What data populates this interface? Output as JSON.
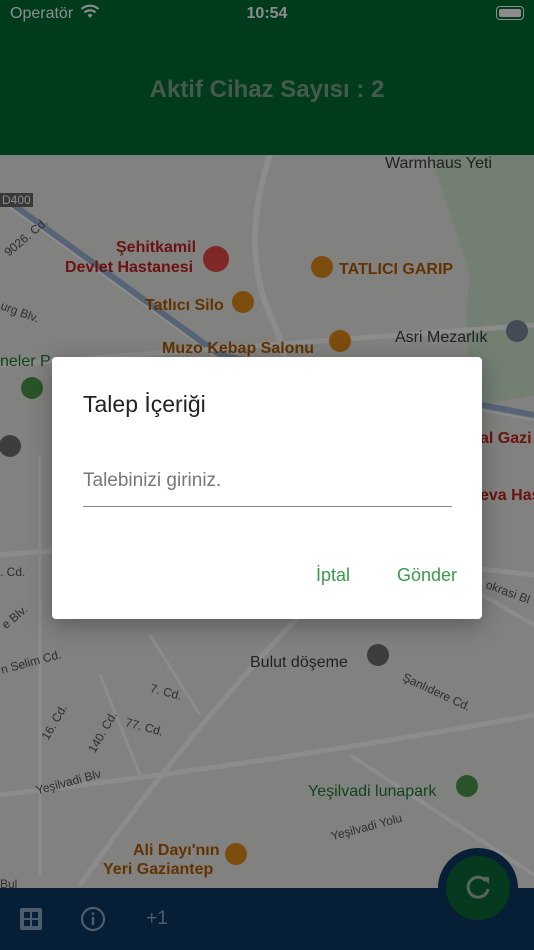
{
  "status_bar": {
    "carrier": "Operatör",
    "time": "10:54"
  },
  "header": {
    "title": "Aktif Cihaz Sayısı : 2"
  },
  "map": {
    "labels": {
      "hospital_line1": "Şehitkamil",
      "hospital_line2": "Devlet Hastanesi",
      "tatlici_garip": "TATLICI GARIP",
      "tatlici_silo": "Tatlıcı Silo",
      "muzo": "Muzo Kebap Salonu",
      "asri": "Asri Mezarlık",
      "bulut": "Bulut döşeme",
      "yesilvadi_park": "Yeşilvadi lunapark",
      "ali_line1": "Ali Dayı'nın",
      "ali_line2": "Yeri Gaziantep",
      "warmhaus": "Warmhaus Yeti",
      "d400": "D400",
      "st_9026": "9026. Cd.",
      "st_burg": "urg Blv.",
      "st_neler": "neler P",
      "st_selim": "n Selim Cd.",
      "st_7": "7. Cd.",
      "st_16": "16. Cd.",
      "st_140": "140. Cd.",
      "st_77": "77. Cd.",
      "st_yesilvadi_blv": "Yeşilvadi Blv",
      "st_yesilvadi_yolu": "Yeşilvadi Yolu",
      "st_sanlidere": "Şanlıdere Cd.",
      "st_okrasi": "okrasi Bl",
      "st_cd": ". Cd.",
      "st_blv": "e Blv.",
      "st_gazi": "al Gazi",
      "st_has": "eva Has",
      "st_bul": "Bul"
    }
  },
  "dialog": {
    "title": "Talep İçeriği",
    "input_placeholder": "Talebinizi giriniz.",
    "input_value": "",
    "cancel_label": "İptal",
    "submit_label": "Gönder"
  },
  "bottom_bar": {
    "counter_label": "+1"
  },
  "colors": {
    "header_bg": "#006d34",
    "bottom_bar_bg": "#0b3a63",
    "accent_green": "#3a9a4a"
  }
}
